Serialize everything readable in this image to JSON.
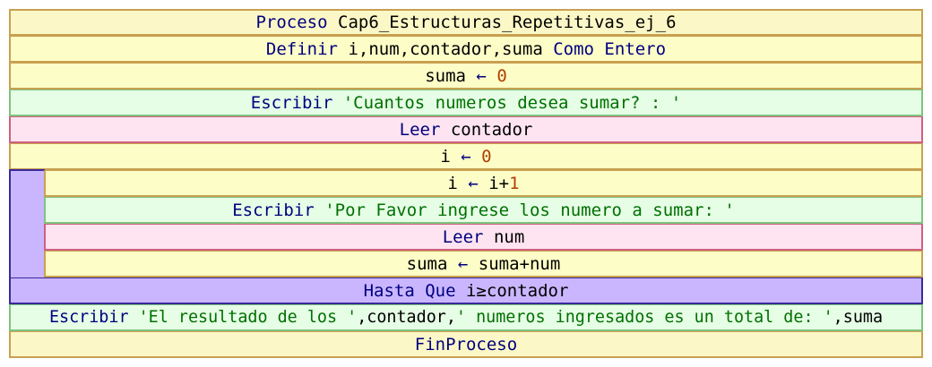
{
  "rows": {
    "proceso": {
      "kw": "Proceso",
      "name": "Cap6_Estructuras_Repetitivas_ej_6"
    },
    "definir": {
      "kw": "Definir",
      "vars": "i,num,contador,suma",
      "kw2": "Como Entero"
    },
    "suma_init": {
      "var": "suma",
      "arrow": "←",
      "val": "0"
    },
    "escribir1": {
      "kw": "Escribir",
      "text": "'Cuantos numeros desea sumar? : '"
    },
    "leer1": {
      "kw": "Leer",
      "var": "contador"
    },
    "i_init": {
      "var": "i",
      "arrow": "←",
      "val": "0"
    },
    "i_inc": {
      "var": "i",
      "arrow": "←",
      "expr": "i+",
      "val": "1"
    },
    "escribir2": {
      "kw": "Escribir",
      "text": "'Por Favor ingrese los numero a sumar: '"
    },
    "leer2": {
      "kw": "Leer",
      "var": "num"
    },
    "suma_inc": {
      "var": "suma",
      "arrow": "←",
      "expr": "suma+num"
    },
    "hasta": {
      "kw": "Hasta Que",
      "cond": "i≥contador"
    },
    "escribir3": {
      "kw": "Escribir",
      "s1": "'El resultado de los '",
      "c1": ",contador,",
      "s2": "' numeros ingresados es un total de: '",
      "c2": ",suma"
    },
    "finproceso": {
      "kw": "FinProceso"
    }
  },
  "colors": {
    "keyword": "#000080",
    "number": "#b04000",
    "string": "#007000",
    "loop_fill": "#c9b6ff"
  }
}
